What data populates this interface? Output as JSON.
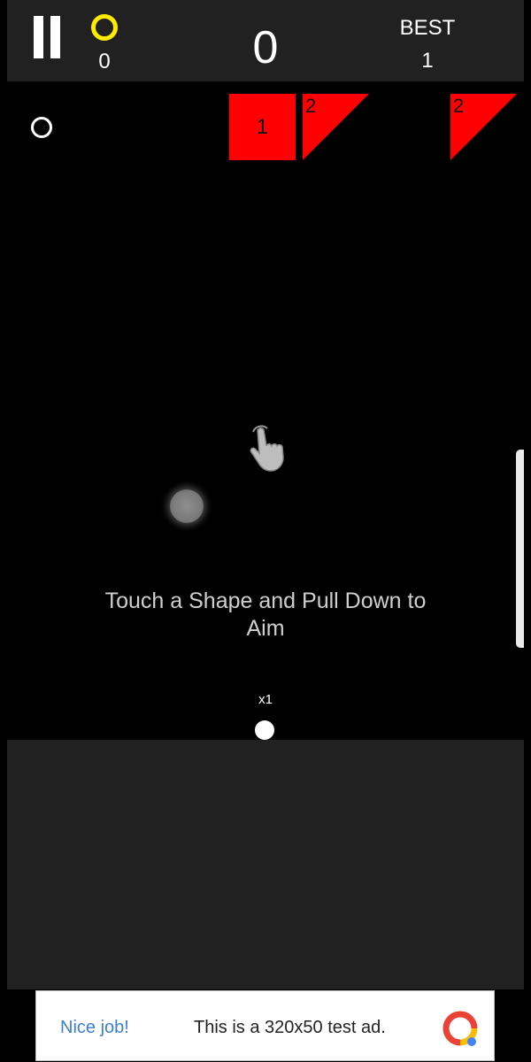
{
  "hud": {
    "ring_count": "0",
    "score": "0",
    "best_label": "BEST",
    "best_value": "1",
    "ring_color": "#ffea00"
  },
  "shapes": [
    {
      "kind": "square",
      "hits": "1",
      "color": "#ff0000"
    },
    {
      "kind": "triangle",
      "hits": "2",
      "color": "#ff0000"
    },
    {
      "kind": "triangle",
      "hits": "2",
      "color": "#ff0000"
    }
  ],
  "hint_text": "Touch a Shape and Pull Down to Aim",
  "ball": {
    "multiplier": "x1",
    "color": "#ffffff"
  },
  "ad": {
    "title": "Nice job!",
    "text": "This is a 320x50 test ad."
  },
  "icons": [
    "pause-icon",
    "ring-icon",
    "pointing-hand-icon",
    "ad-logo-icon"
  ]
}
